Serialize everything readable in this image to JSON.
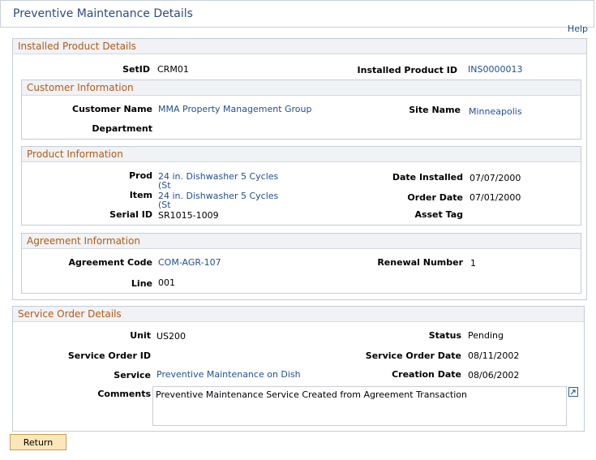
{
  "page": {
    "title": "Preventive Maintenance Details",
    "help": "Help"
  },
  "installed_product": {
    "title": "Installed Product Details",
    "setid_label": "SetID",
    "setid_value": "CRM01",
    "ipid_label": "Installed Product ID",
    "ipid_value": "INS0000013"
  },
  "customer": {
    "title": "Customer Information",
    "customer_name_label": "Customer Name",
    "customer_name_value": "MMA Property Management Group",
    "site_name_label": "Site Name",
    "site_name_value": "Minneapolis",
    "department_label": "Department"
  },
  "product": {
    "title": "Product Information",
    "prod_label": "Prod",
    "prod_line1": "24 in. Dishwasher 5 Cycles",
    "prod_line2": "(St",
    "item_label": "Item",
    "item_line1": "24 in. Dishwasher 5 Cycles",
    "item_line2": "(St",
    "serial_label": "Serial ID",
    "serial_value": "SR1015-1009",
    "date_installed_label": "Date Installed",
    "date_installed_value": "07/07/2000",
    "order_date_label": "Order Date",
    "order_date_value": "07/01/2000",
    "asset_tag_label": "Asset Tag"
  },
  "agreement": {
    "title": "Agreement Information",
    "code_label": "Agreement Code",
    "code_value": "COM-AGR-107",
    "renewal_label": "Renewal Number",
    "renewal_value": "1",
    "line_label": "Line",
    "line_value": "001"
  },
  "service_order": {
    "title": "Service Order Details",
    "unit_label": "Unit",
    "unit_value": "US200",
    "status_label": "Status",
    "status_value": "Pending",
    "so_id_label": "Service Order ID",
    "so_date_label": "Service Order Date",
    "so_date_value": "08/11/2002",
    "service_label": "Service",
    "service_value": "Preventive Maintenance on Dish",
    "creation_label": "Creation Date",
    "creation_value": "08/06/2002",
    "comments_label": "Comments",
    "comments_value": "Preventive Maintenance Service Created from Agreement Transaction"
  },
  "buttons": {
    "return": "Return"
  }
}
